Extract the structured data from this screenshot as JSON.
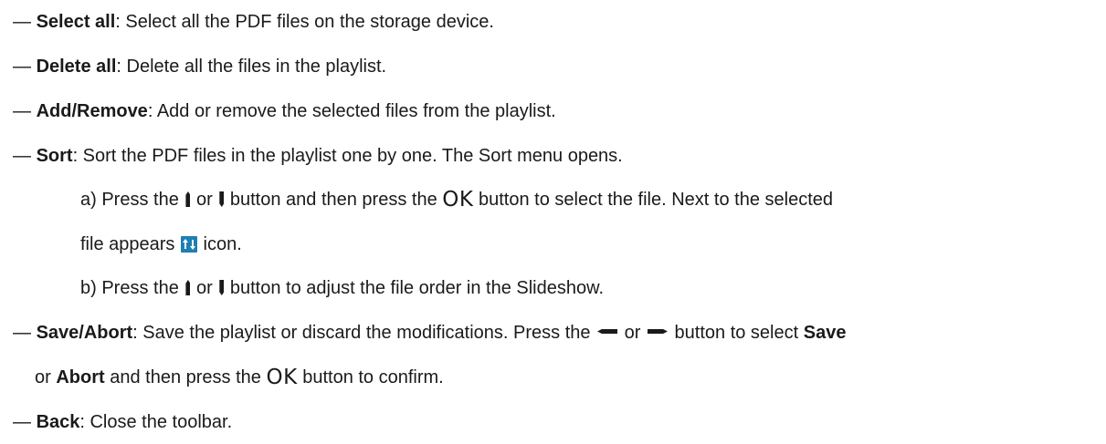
{
  "doc": {
    "dash": "—",
    "ok_label": "OK",
    "items": [
      {
        "term": "Select all",
        "text": ": Select all the PDF files on the storage device."
      },
      {
        "term": "Delete all",
        "text": ": Delete all the files in the playlist."
      },
      {
        "term": "Add/Remove",
        "text": ": Add or remove the selected files from the playlist."
      },
      {
        "term": "Sort",
        "text": ": Sort the PDF files in the playlist one by one. The Sort menu opens."
      }
    ],
    "sort_steps": {
      "a_prefix": "a) Press the ",
      "a_or": " or ",
      "a_mid": " button and then press the ",
      "a_end": " button to select the file. Next to the selected",
      "a_cont_pre": "file appears ",
      "a_cont_post": " icon.",
      "b_prefix": "b) Press the ",
      "b_or": " or ",
      "b_end": " button to adjust the file order in the Slideshow."
    },
    "save_abort": {
      "term": "Save/Abort",
      "text": ": Save the playlist or discard the modifications. Press the ",
      "or": " or ",
      "mid": " button to select ",
      "save": "Save",
      "cont_or": "or ",
      "abort": "Abort",
      "cont_mid": " and then press the ",
      "cont_end": " button to confirm."
    },
    "back": {
      "term": "Back",
      "text": ": Close the toolbar."
    }
  },
  "icons": {
    "up": "up-arrow-icon",
    "down": "down-arrow-icon",
    "left": "left-arrow-icon",
    "right": "right-arrow-icon",
    "sort": "sort-icon"
  },
  "colors": {
    "text": "#1a1a1a",
    "sort_icon_bg": "#1f7fb0",
    "sort_icon_fg": "#ffffff"
  }
}
